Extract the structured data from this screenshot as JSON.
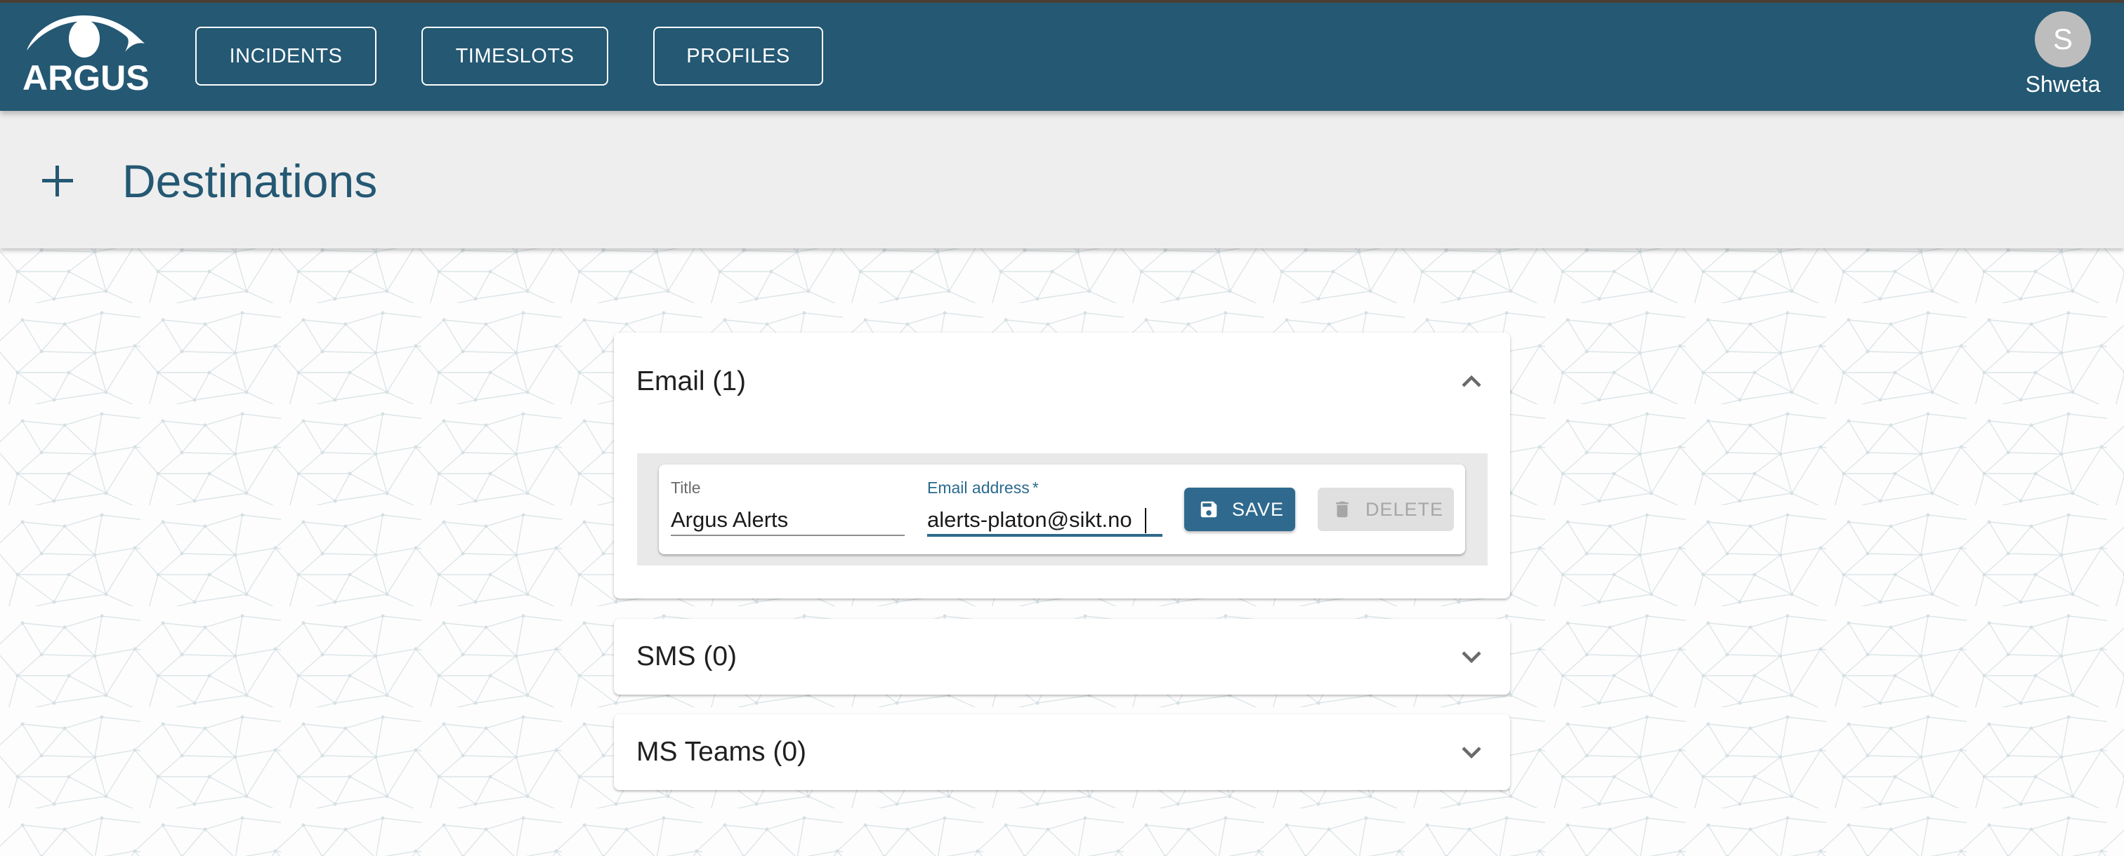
{
  "app": {
    "logo_text": "ARGUS",
    "brand_color": "#245873"
  },
  "nav": {
    "items": [
      {
        "label": "INCIDENTS"
      },
      {
        "label": "TIMESLOTS"
      },
      {
        "label": "PROFILES"
      }
    ]
  },
  "user": {
    "initial": "S",
    "name": "Shweta"
  },
  "page": {
    "title": "Destinations",
    "add_icon": "plus-icon"
  },
  "sections": {
    "email": {
      "title": "Email (1)",
      "expanded": true,
      "toggle_icon": "chevron-up-icon",
      "entries": [
        {
          "title_label": "Title",
          "title_value": "Argus Alerts",
          "email_label": "Email address",
          "email_required_marker": "*",
          "email_value": "alerts-platon@sikt.no",
          "save_label": "SAVE",
          "save_icon": "floppy-disk-icon",
          "delete_label": "DELETE",
          "delete_icon": "trash-icon",
          "delete_disabled": true
        }
      ]
    },
    "sms": {
      "title": "SMS (0)",
      "expanded": false,
      "toggle_icon": "chevron-down-icon"
    },
    "teams": {
      "title": "MS Teams (0)",
      "expanded": false,
      "toggle_icon": "chevron-down-icon"
    }
  },
  "colors": {
    "accent": "#2f6a8e",
    "disabled_bg": "#e0e0e0",
    "disabled_text": "#a6a6a6",
    "titlebar_bg": "#eeeeee"
  }
}
